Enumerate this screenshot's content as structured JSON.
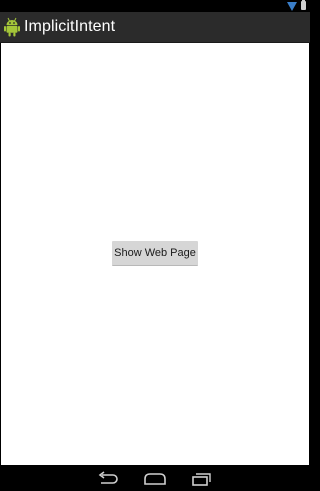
{
  "status_bar": {
    "icons": [
      "wifi-signal-icon",
      "battery-icon"
    ],
    "colors": {
      "background": "#000000",
      "signal": "#3a7ec8"
    }
  },
  "action_bar": {
    "title": "ImplicitIntent",
    "icon": "android-launcher-icon",
    "colors": {
      "background": "#2b2b2b",
      "title": "#ffffff"
    }
  },
  "main": {
    "show_web_page_button": {
      "label": "Show Web Page"
    },
    "colors": {
      "background": "#ffffff",
      "button": "#d6d6d6"
    }
  },
  "nav_bar": {
    "buttons": [
      "back-icon",
      "home-icon",
      "recent-apps-icon"
    ],
    "colors": {
      "background": "#000000",
      "icons": "#cfcfcf"
    }
  }
}
